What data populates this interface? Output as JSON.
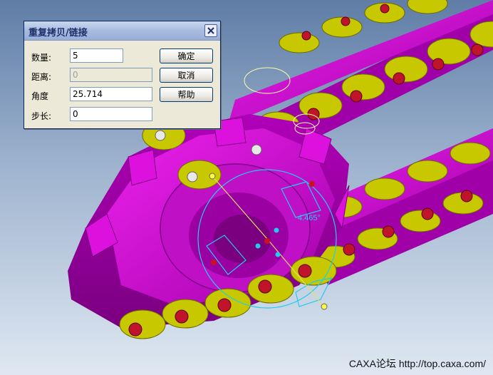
{
  "dialog": {
    "title": "重复拷贝/链接",
    "fields": [
      {
        "label": "数量:",
        "value": "5",
        "disabled": false
      },
      {
        "label": "距离:",
        "value": "0",
        "disabled": true
      },
      {
        "label": "角度",
        "value": "25.714",
        "disabled": false
      },
      {
        "label": "步长:",
        "value": "0",
        "disabled": false
      }
    ],
    "buttons": {
      "ok": "确定",
      "cancel": "取消",
      "help": "帮助"
    }
  },
  "viewport": {
    "angle_readout": "4.465°",
    "watermark": "CAXA论坛  http://top.caxa.com/"
  },
  "colors": {
    "sprocket": "#cc11cc",
    "chain_plate": "#c8c800",
    "roller": "#c0142a",
    "manipulator": "#22ccee"
  }
}
